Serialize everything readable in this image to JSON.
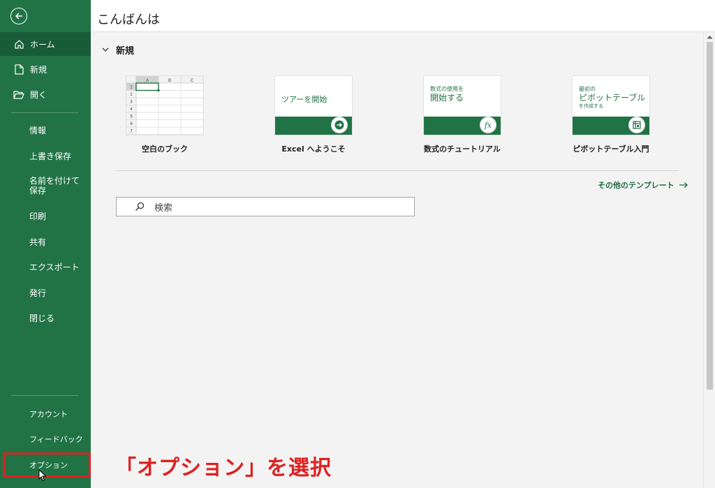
{
  "sidebar": {
    "items": [
      {
        "label": "ホーム",
        "icon": "home-icon"
      },
      {
        "label": "新規",
        "icon": "new-file-icon"
      },
      {
        "label": "開く",
        "icon": "open-folder-icon"
      },
      {
        "label": "情報"
      },
      {
        "label": "上書き保存"
      },
      {
        "label": "名前を付けて保存"
      },
      {
        "label": "印刷"
      },
      {
        "label": "共有"
      },
      {
        "label": "エクスポート"
      },
      {
        "label": "発行"
      },
      {
        "label": "閉じる"
      },
      {
        "label": "アカウント"
      },
      {
        "label": "フィードバック"
      },
      {
        "label": "オプション"
      }
    ],
    "bg_color": "#217346",
    "active_color": "#185c37"
  },
  "header": {
    "greeting": "こんばんは"
  },
  "new_section": {
    "title": "新規",
    "templates": [
      {
        "caption": "空白のブック",
        "grid_cols": [
          "A",
          "B",
          "C"
        ],
        "grid_rows": [
          "1",
          "2",
          "3",
          "4",
          "5",
          "6",
          "7"
        ]
      },
      {
        "caption": "Excel へようこそ",
        "thumb_text": "ツアーを開始",
        "icon": "arrow-right-icon"
      },
      {
        "caption": "数式のチュートリアル",
        "thumb_text_small": "数式の使用を",
        "thumb_text_large": "開始する",
        "icon": "fx-icon"
      },
      {
        "caption": "ピボットテーブル入門",
        "thumb_text_small": "最初の",
        "thumb_text_large": "ピボットテーブル",
        "thumb_text_sub": "を作成する",
        "icon": "pivot-table-icon"
      }
    ],
    "more_templates": "その他のテンプレート"
  },
  "search": {
    "placeholder": "検索"
  },
  "annotation": "「オプション」を選択",
  "accent_red": "#e02020"
}
